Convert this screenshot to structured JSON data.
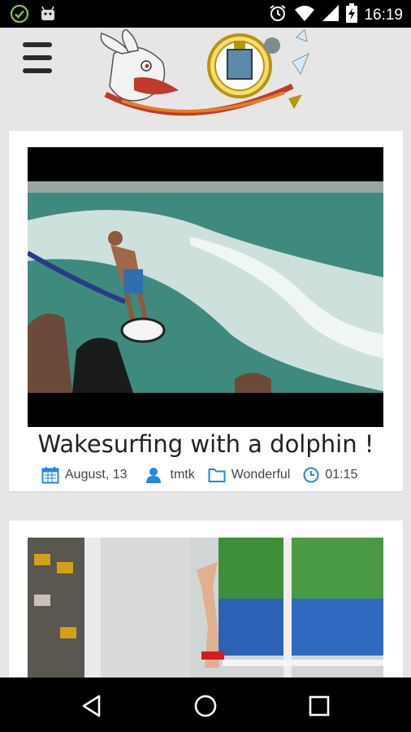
{
  "status_bar": {
    "time": "16:19",
    "icons": [
      "check-circle-icon",
      "android-icon",
      "alarm-icon",
      "wifi-icon",
      "signal-icon",
      "battery-charging-icon"
    ]
  },
  "header": {
    "menu_icon": "hamburger-menu-icon",
    "logo": "white-rabbit-pocket-watch-logo"
  },
  "posts": [
    {
      "title": "Wakesurfing with a dolphin !",
      "date": "August, 13",
      "author": "tmtk",
      "category": "Wonderful",
      "duration": "01:15",
      "thumbnail": "wakesurfing-video-thumbnail"
    },
    {
      "thumbnail": "diver-video-thumbnail"
    }
  ],
  "colors": {
    "accent": "#1e88e5",
    "background": "#e6e6e6",
    "card": "#ffffff"
  },
  "nav_bar": {
    "icons": [
      "back-icon",
      "home-icon",
      "recents-icon"
    ]
  }
}
